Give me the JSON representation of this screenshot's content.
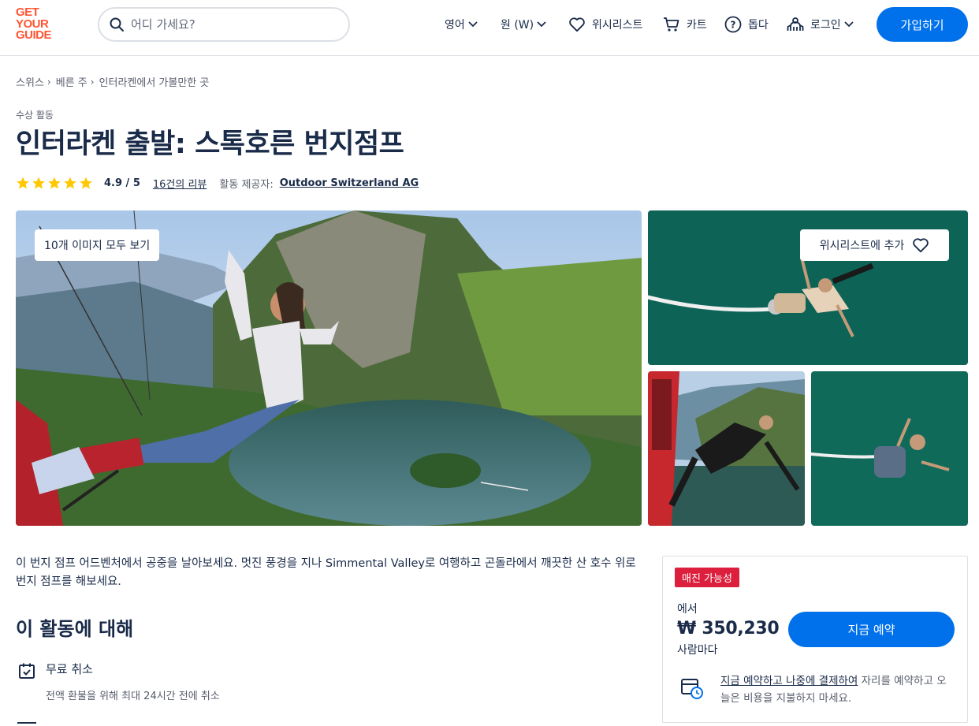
{
  "header": {
    "logo_lines": [
      "GET",
      "YOUR",
      "GUIDE"
    ],
    "search_placeholder": "어디 가세요?",
    "language": "영어",
    "currency": "원 (W)",
    "wishlist": "위시리스트",
    "cart": "카트",
    "help": "돕다",
    "login": "로그인",
    "signup": "가입하기"
  },
  "breadcrumb": [
    "스위스",
    "베른 주",
    "인터라켄에서 가볼만한 곳"
  ],
  "activity": {
    "category": "수상 활동",
    "title": "인터라켄 출발: 스톡호른 번지점프",
    "rating_text": "4.9 / 5",
    "rating_value": 4.9,
    "rating_max": 5,
    "reviews": "16건의 리뷰",
    "provider_label": "활동 제공자:",
    "provider": "Outdoor Switzerland AG"
  },
  "gallery": {
    "view_all": "10개 이미지 모두 보기",
    "add_wishlist": "위시리스트에 추가"
  },
  "summary": "이 번지 점프 어드벤처에서 공중을 날아보세요. 멋진 풍경을 지나 Simmental Valley로 여행하고 곤돌라에서 깨끗한 산 호수 위로 번지 점프를 해보세요.",
  "about": {
    "title": "이 활동에 대해",
    "features": [
      {
        "title": "무료 취소",
        "desc": "전액 환불을 위해 최대 24시간 전에 취소",
        "icon": "calendar-check-icon"
      }
    ]
  },
  "booking": {
    "badge": "매진 가능성",
    "from": "에서",
    "price": "₩ 350,230",
    "per": "사람마다",
    "book_now": "지금 예약",
    "rnpl_link": "지금 예약하고 나중에 결제하여",
    "rnpl_text": " 자리를 예약하고 오늘은 비용을 지불하지 마세요."
  },
  "colors": {
    "brand": "#ff5533",
    "primary": "#0071eb",
    "badge": "#dc1f3c",
    "star": "#ffc800",
    "text": "#1a2b49"
  }
}
